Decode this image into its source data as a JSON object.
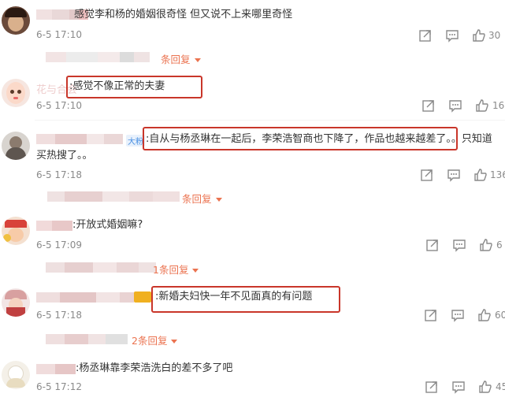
{
  "comments": [
    {
      "text": "感觉李和杨的婚姻很奇怪 但又说不上来哪里奇怪",
      "time": "6-5 17:10",
      "likes": "30"
    },
    {
      "text": ":感觉不像正常的夫妻",
      "time": "6-5 17:10",
      "likes": "16",
      "user_partial": "花与合会"
    },
    {
      "text": ":自从与杨丞琳在一起后，李荣浩智商也下降了，作品也越来越差了。。只知道",
      "text2": "买热搜了。。",
      "time": "6-5 17:18",
      "likes": "136",
      "badge": "大粉"
    },
    {
      "text": ":开放式婚姻嘛?",
      "time": "6-5 17:09",
      "likes": "6"
    },
    {
      "text": ":新婚夫妇快一年不见面真的有问题",
      "time": "6-5 17:18",
      "likes": "60"
    },
    {
      "text": ":杨丞琳靠李荣浩洗白的差不多了吧",
      "time": "6-5 17:12",
      "likes": "45"
    }
  ],
  "replies": [
    "条回复",
    "条回复",
    "1条回复",
    "2条回复"
  ],
  "icons": {
    "share": "share-icon",
    "comment": "comment-icon",
    "like": "thumbs-up-icon"
  },
  "colors": {
    "reply": "#eb7350",
    "highlight": "#c9362a",
    "time": "#8a8a8a"
  }
}
